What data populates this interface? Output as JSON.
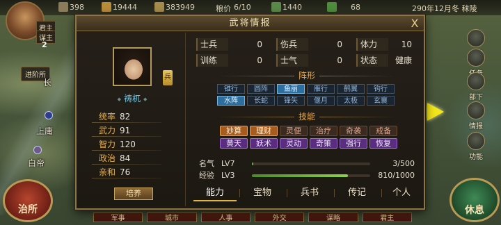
{
  "topbar": {
    "res1": "398",
    "res2": "19444",
    "res3": "383949",
    "grain_label": "粮价",
    "grain_value": "6/10",
    "res4": "1440",
    "res5": "68",
    "date": "290年12月冬 秣陵"
  },
  "lord": {
    "tag1": "君主",
    "tag2": "谋主",
    "badge": "2"
  },
  "map": {
    "promote": "进阶所",
    "city_shangyong": "上庸",
    "city_baidi": "白帝",
    "city_chang": "长"
  },
  "side_buttons": {
    "shop": "商城",
    "task": "任务",
    "troops": "部下",
    "intel": "情报",
    "function": "功能"
  },
  "left_round": "治所",
  "right_round": "休息",
  "bottom_nav": [
    "军事",
    "城市",
    "人事",
    "外交",
    "谋略",
    "君主"
  ],
  "dialog": {
    "title": "武将情报",
    "close": "X",
    "class_badge": "兵",
    "general_name": "祷杌",
    "stats": [
      {
        "k": "统率",
        "v": "82"
      },
      {
        "k": "武力",
        "v": "91"
      },
      {
        "k": "智力",
        "v": "120"
      },
      {
        "k": "政治",
        "v": "84"
      },
      {
        "k": "亲和",
        "v": "76"
      }
    ],
    "cultivate": "培养",
    "info": [
      [
        {
          "k": "士兵",
          "v": "0"
        },
        {
          "k": "伤兵",
          "v": "0"
        },
        {
          "k": "体力",
          "v": "10"
        }
      ],
      [
        {
          "k": "训练",
          "v": "0"
        },
        {
          "k": "士气",
          "v": "0"
        },
        {
          "k": "状态",
          "v": "健康"
        }
      ]
    ],
    "formation_title": "阵形",
    "formations": [
      {
        "label": "锥行",
        "on": false
      },
      {
        "label": "圆阵",
        "on": false
      },
      {
        "label": "鱼丽",
        "on": true
      },
      {
        "label": "雁行",
        "on": false
      },
      {
        "label": "鹤翼",
        "on": false
      },
      {
        "label": "钩行",
        "on": false
      },
      {
        "label": "水阵",
        "on": true
      },
      {
        "label": "长蛇",
        "on": false
      },
      {
        "label": "锋矢",
        "on": false
      },
      {
        "label": "偃月",
        "on": false
      },
      {
        "label": "太极",
        "on": false
      },
      {
        "label": "玄襄",
        "on": false
      }
    ],
    "skills_title": "技能",
    "skills": [
      {
        "label": "妙算",
        "color": "orange"
      },
      {
        "label": "理财",
        "color": "orange"
      },
      {
        "label": "灵便",
        "color": "brown"
      },
      {
        "label": "治疗",
        "color": "brown"
      },
      {
        "label": "奇袭",
        "color": "brown"
      },
      {
        "label": "戒备",
        "color": "brown"
      },
      {
        "label": "黄天",
        "color": "purple"
      },
      {
        "label": "妖术",
        "color": "purple"
      },
      {
        "label": "灵动",
        "color": "purple"
      },
      {
        "label": "奇策",
        "color": "purple"
      },
      {
        "label": "强行",
        "color": "purple"
      },
      {
        "label": "恢复",
        "color": "purple"
      }
    ],
    "fame": {
      "name": "名气",
      "lv": "LV7",
      "num": "3/500",
      "ratio": 0.006
    },
    "exp": {
      "name": "经验",
      "lv": "LV3",
      "num": "810/1000",
      "ratio": 0.81
    },
    "tabs": [
      "能力",
      "宝物",
      "兵书",
      "传记",
      "个人"
    ],
    "active_tab": 0
  }
}
